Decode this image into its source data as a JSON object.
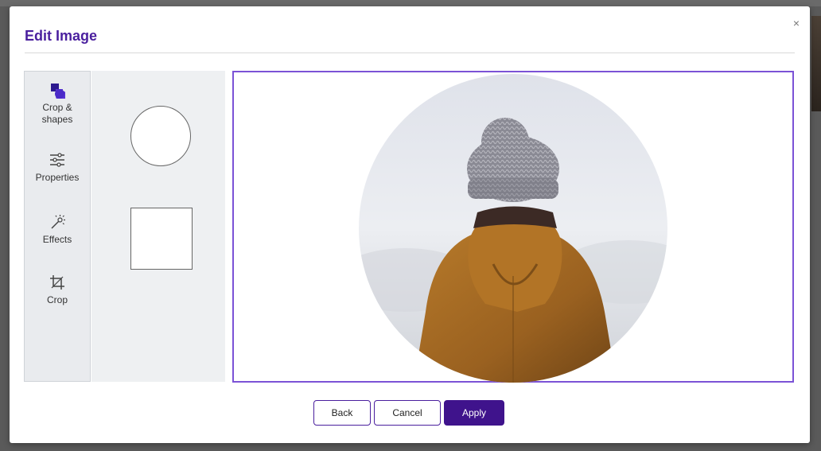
{
  "dialog": {
    "title": "Edit Image",
    "close_label": "×"
  },
  "tools": [
    {
      "label": "Crop &\nshapes",
      "icon": "crop-shapes-icon",
      "active": true
    },
    {
      "label": "Properties",
      "icon": "sliders-icon",
      "active": false
    },
    {
      "label": "Effects",
      "icon": "magic-wand-icon",
      "active": false
    },
    {
      "label": "Crop",
      "icon": "crop-icon",
      "active": false
    }
  ],
  "shapes": [
    {
      "name": "circle",
      "selected": true
    },
    {
      "name": "square",
      "selected": false
    }
  ],
  "preview": {
    "mask_shape": "circle",
    "subject": "person in knit beanie and mustard hooded jacket, seen from behind, foggy background"
  },
  "buttons": {
    "back": "Back",
    "cancel": "Cancel",
    "apply": "Apply"
  },
  "colors": {
    "accent": "#4a1f9e",
    "primary_button": "#3f138c",
    "canvas_border": "#7b52d6",
    "panel_bg": "#eef0f2"
  }
}
